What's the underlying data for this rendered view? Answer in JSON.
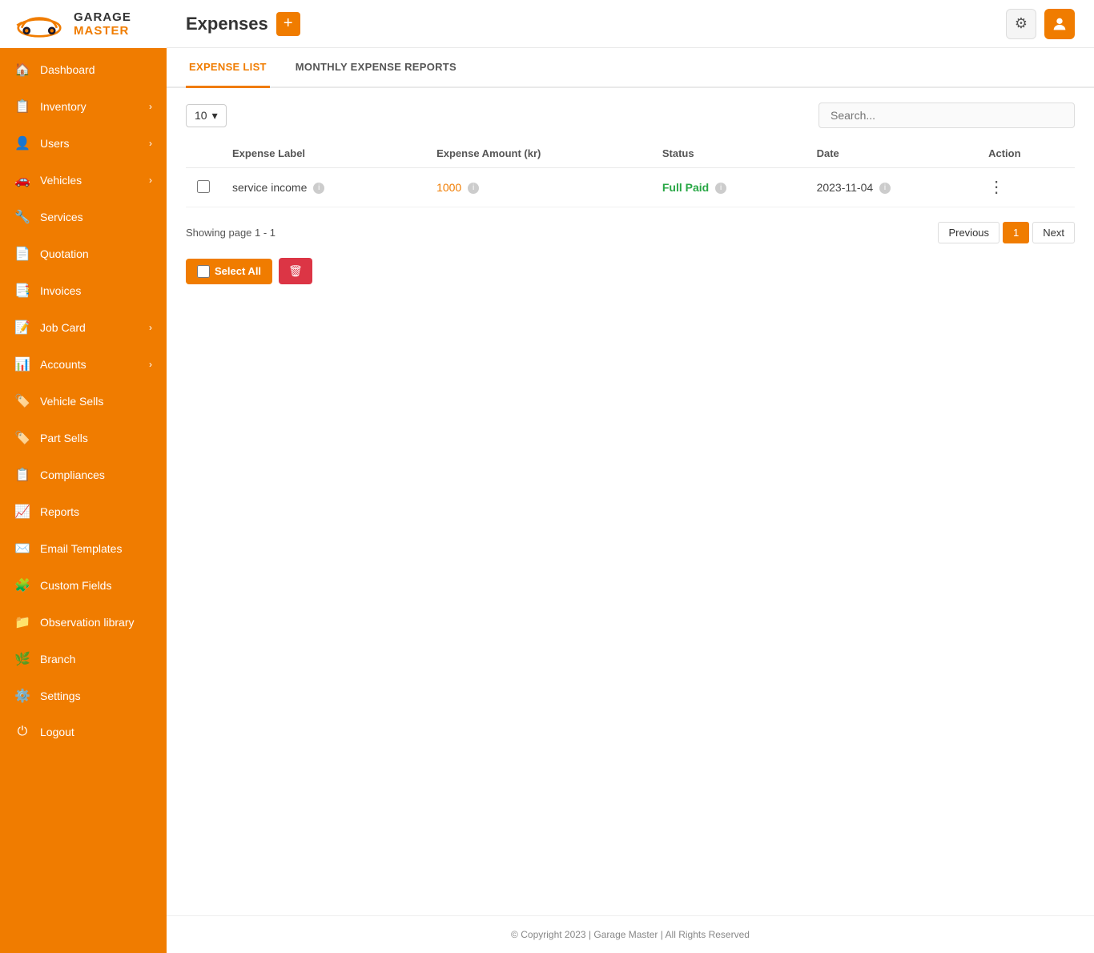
{
  "brand": {
    "name_top": "GARAGE",
    "name_bottom": "MASTER"
  },
  "sidebar": {
    "items": [
      {
        "id": "dashboard",
        "label": "Dashboard",
        "icon": "🏠",
        "has_arrow": false
      },
      {
        "id": "inventory",
        "label": "Inventory",
        "icon": "📋",
        "has_arrow": true
      },
      {
        "id": "users",
        "label": "Users",
        "icon": "👤",
        "has_arrow": true
      },
      {
        "id": "vehicles",
        "label": "Vehicles",
        "icon": "🚗",
        "has_arrow": true
      },
      {
        "id": "services",
        "label": "Services",
        "icon": "🔧",
        "has_arrow": false
      },
      {
        "id": "quotation",
        "label": "Quotation",
        "icon": "📄",
        "has_arrow": false
      },
      {
        "id": "invoices",
        "label": "Invoices",
        "icon": "📑",
        "has_arrow": false
      },
      {
        "id": "job-card",
        "label": "Job Card",
        "icon": "📝",
        "has_arrow": true
      },
      {
        "id": "accounts",
        "label": "Accounts",
        "icon": "📊",
        "has_arrow": true
      },
      {
        "id": "vehicle-sells",
        "label": "Vehicle Sells",
        "icon": "🏷️",
        "has_arrow": false
      },
      {
        "id": "part-sells",
        "label": "Part Sells",
        "icon": "🏷️",
        "has_arrow": false
      },
      {
        "id": "compliances",
        "label": "Compliances",
        "icon": "📋",
        "has_arrow": false
      },
      {
        "id": "reports",
        "label": "Reports",
        "icon": "📈",
        "has_arrow": false
      },
      {
        "id": "email-templates",
        "label": "Email Templates",
        "icon": "✉️",
        "has_arrow": false
      },
      {
        "id": "custom-fields",
        "label": "Custom Fields",
        "icon": "🧩",
        "has_arrow": false
      },
      {
        "id": "observation-library",
        "label": "Observation library",
        "icon": "📁",
        "has_arrow": false
      },
      {
        "id": "branch",
        "label": "Branch",
        "icon": "🌿",
        "has_arrow": false
      },
      {
        "id": "settings",
        "label": "Settings",
        "icon": "⚙️",
        "has_arrow": false
      },
      {
        "id": "logout",
        "label": "Logout",
        "icon": "⏻",
        "has_arrow": false
      }
    ]
  },
  "header": {
    "title": "Expenses",
    "add_button_label": "+",
    "settings_icon": "⚙",
    "user_icon": "👤"
  },
  "tabs": [
    {
      "id": "expense-list",
      "label": "EXPENSE LIST",
      "active": true
    },
    {
      "id": "monthly-expense-reports",
      "label": "MONTHLY EXPENSE REPORTS",
      "active": false
    }
  ],
  "table": {
    "per_page": "10",
    "search_placeholder": "Search...",
    "columns": [
      {
        "id": "checkbox",
        "label": ""
      },
      {
        "id": "expense-label",
        "label": "Expense Label"
      },
      {
        "id": "expense-amount",
        "label": "Expense Amount (kr)"
      },
      {
        "id": "status",
        "label": "Status"
      },
      {
        "id": "date",
        "label": "Date"
      },
      {
        "id": "action",
        "label": "Action"
      }
    ],
    "rows": [
      {
        "expense_label": "service income",
        "expense_amount": "1000",
        "status": "Full Paid",
        "date": "2023-11-04",
        "action": "⋮"
      }
    ]
  },
  "pagination": {
    "showing_text": "Showing page 1 - 1",
    "previous_label": "Previous",
    "page_number": "1",
    "next_label": "Next"
  },
  "bulk_actions": {
    "select_all_label": "Select All",
    "delete_icon": "🗑"
  },
  "footer": {
    "text": "© Copyright 2023 | Garage Master | All Rights Reserved"
  }
}
